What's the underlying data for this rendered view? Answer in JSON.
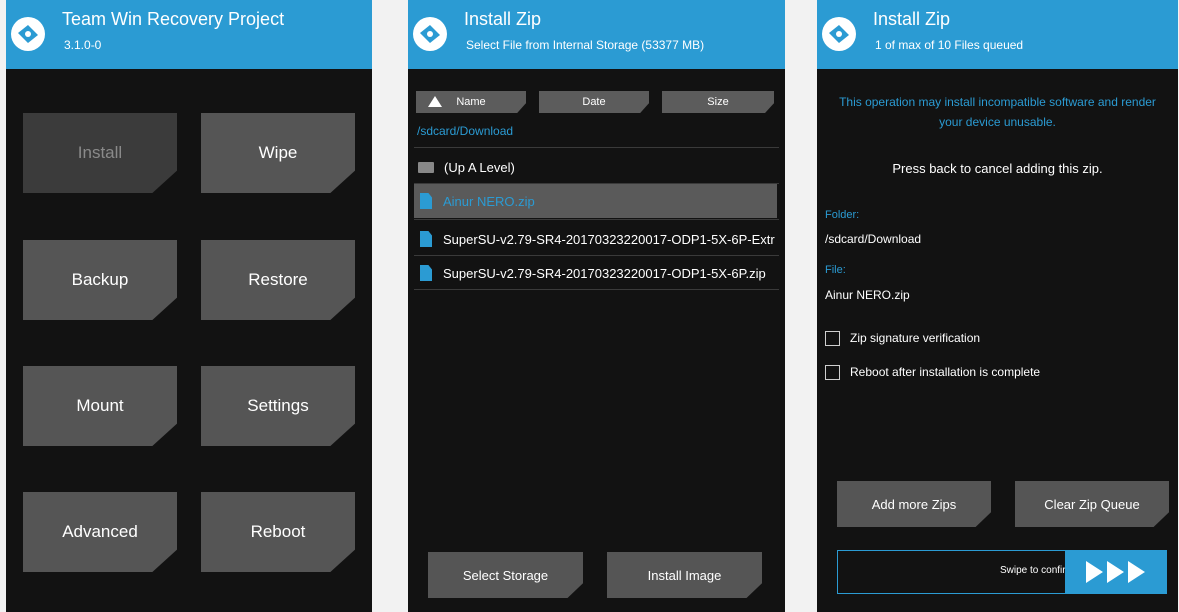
{
  "colors": {
    "accent": "#2b9bd3",
    "background": "#121212",
    "tile": "#555555"
  },
  "home": {
    "title": "Team Win Recovery Project",
    "version": "3.1.0-0",
    "tiles": [
      "Install",
      "Wipe",
      "Backup",
      "Restore",
      "Mount",
      "Settings",
      "Advanced",
      "Reboot"
    ],
    "active_tile": "Install"
  },
  "browser": {
    "title": "Install Zip",
    "subtitle": "Select File from Internal Storage (53377 MB)",
    "sort": {
      "name": "Name",
      "date": "Date",
      "size": "Size"
    },
    "path": "/sdcard/Download",
    "rows": [
      {
        "icon": "folder-icon",
        "label": "(Up A Level)"
      },
      {
        "icon": "zip-file-icon",
        "label": "Ainur NERO.zip",
        "selected": true
      },
      {
        "icon": "zip-file-icon",
        "label": "SuperSU-v2.79-SR4-20170323220017-ODP1-5X-6P-Extr"
      },
      {
        "icon": "zip-file-icon",
        "label": "SuperSU-v2.79-SR4-20170323220017-ODP1-5X-6P.zip"
      }
    ],
    "select_storage": "Select Storage",
    "install_image": "Install Image"
  },
  "confirm": {
    "title": "Install Zip",
    "subtitle": "1 of max of 10 Files queued",
    "warning": "This operation may install incompatible software and render your device unusable.",
    "cancel_hint": "Press back to cancel adding this zip.",
    "folder_label": "Folder:",
    "folder_value": "/sdcard/Download",
    "file_label": "File:",
    "file_value": "Ainur NERO.zip",
    "checkbox_signature": "Zip signature verification",
    "checkbox_reboot": "Reboot after installation is complete",
    "add_more": "Add more Zips",
    "clear_queue": "Clear Zip Queue",
    "swipe_text": "Swipe to confirm Flash"
  }
}
